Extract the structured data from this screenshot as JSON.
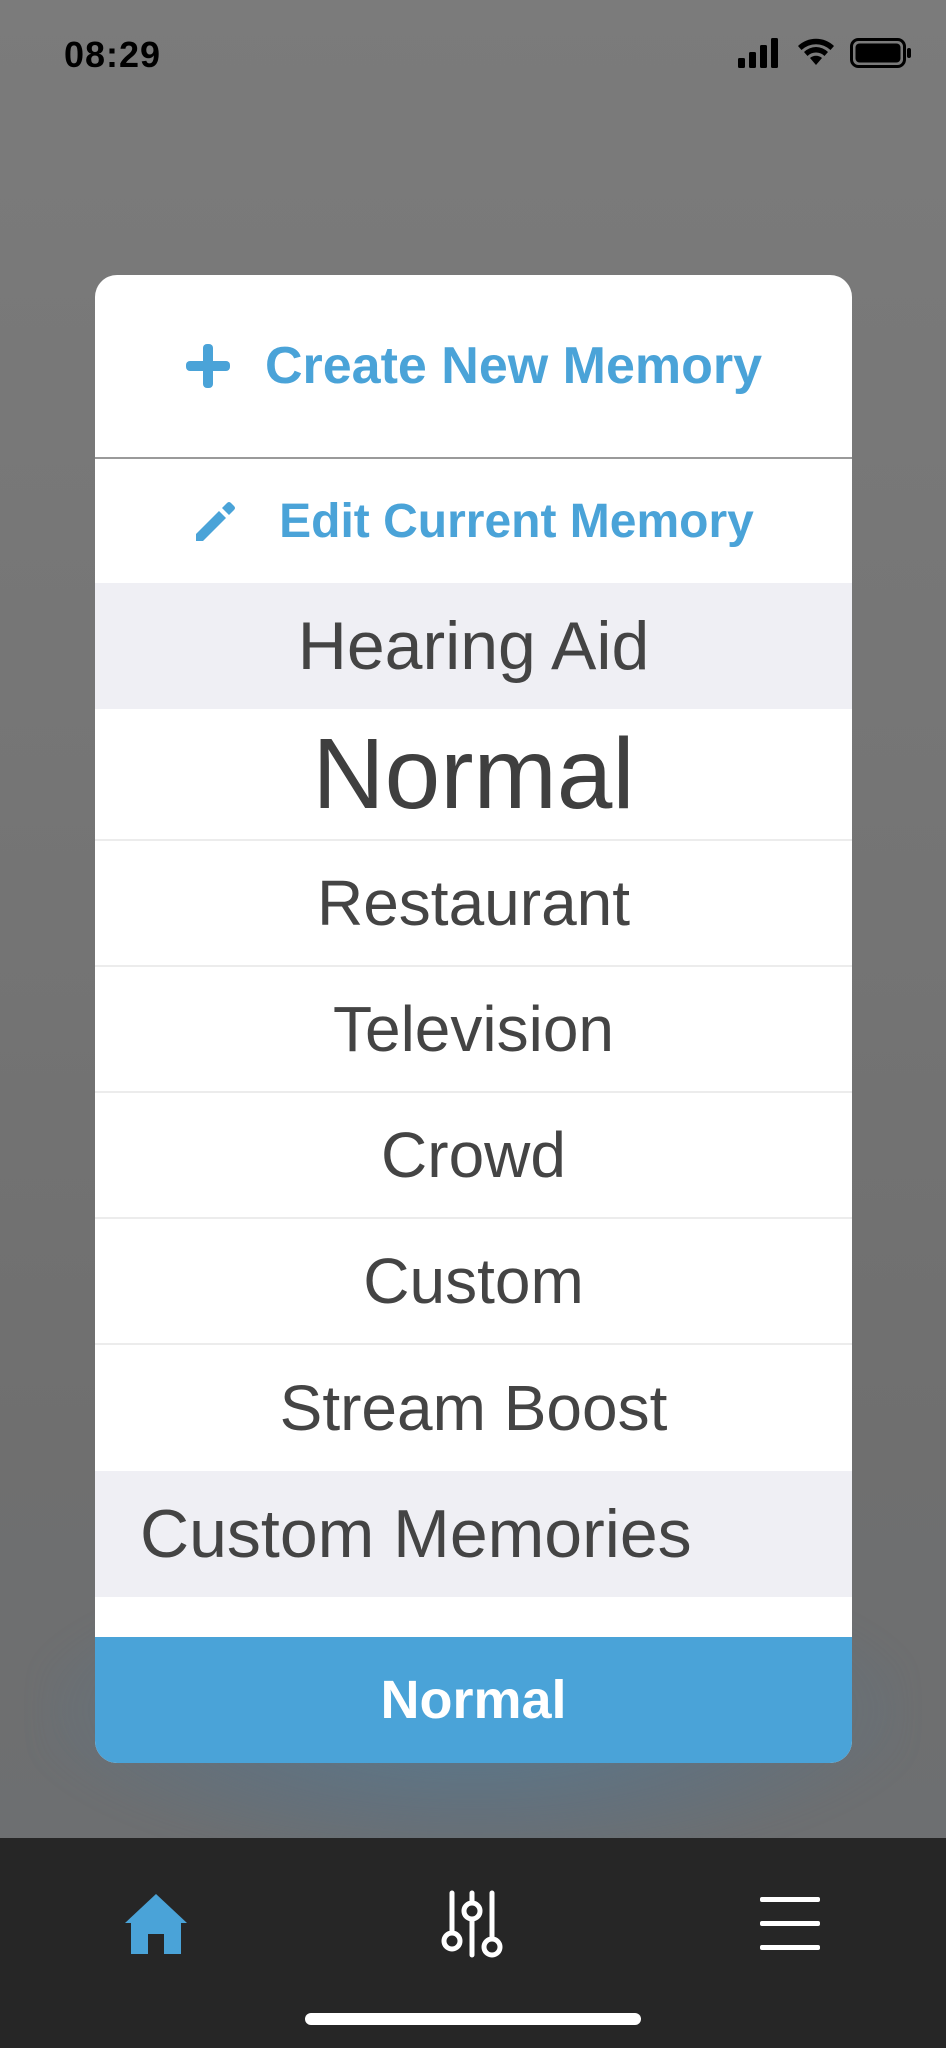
{
  "status_bar": {
    "time": "08:29",
    "icons": [
      "cellular-signal-icon",
      "wifi-icon",
      "battery-icon"
    ]
  },
  "memory_sheet": {
    "create_label": "Create New Memory",
    "create_icon": "plus-icon",
    "edit_label": "Edit Current Memory",
    "edit_icon": "pencil-icon",
    "sections": [
      {
        "header": "Hearing Aid",
        "items": [
          "Normal",
          "Restaurant",
          "Television",
          "Crowd",
          "Custom",
          "Stream Boost"
        ],
        "selected": "Normal"
      },
      {
        "header": "Custom Memories",
        "items": []
      }
    ],
    "current_button_label": "Normal"
  },
  "tab_bar": {
    "tabs": [
      {
        "name": "home",
        "icon": "home-icon",
        "active": true
      },
      {
        "name": "adjust",
        "icon": "sliders-icon",
        "active": false
      },
      {
        "name": "menu",
        "icon": "hamburger-menu-icon",
        "active": false
      }
    ]
  },
  "colors": {
    "accent": "#4aa3d8",
    "tab_bar": "#262626",
    "section_header": "#efeff4",
    "text": "#444444"
  }
}
